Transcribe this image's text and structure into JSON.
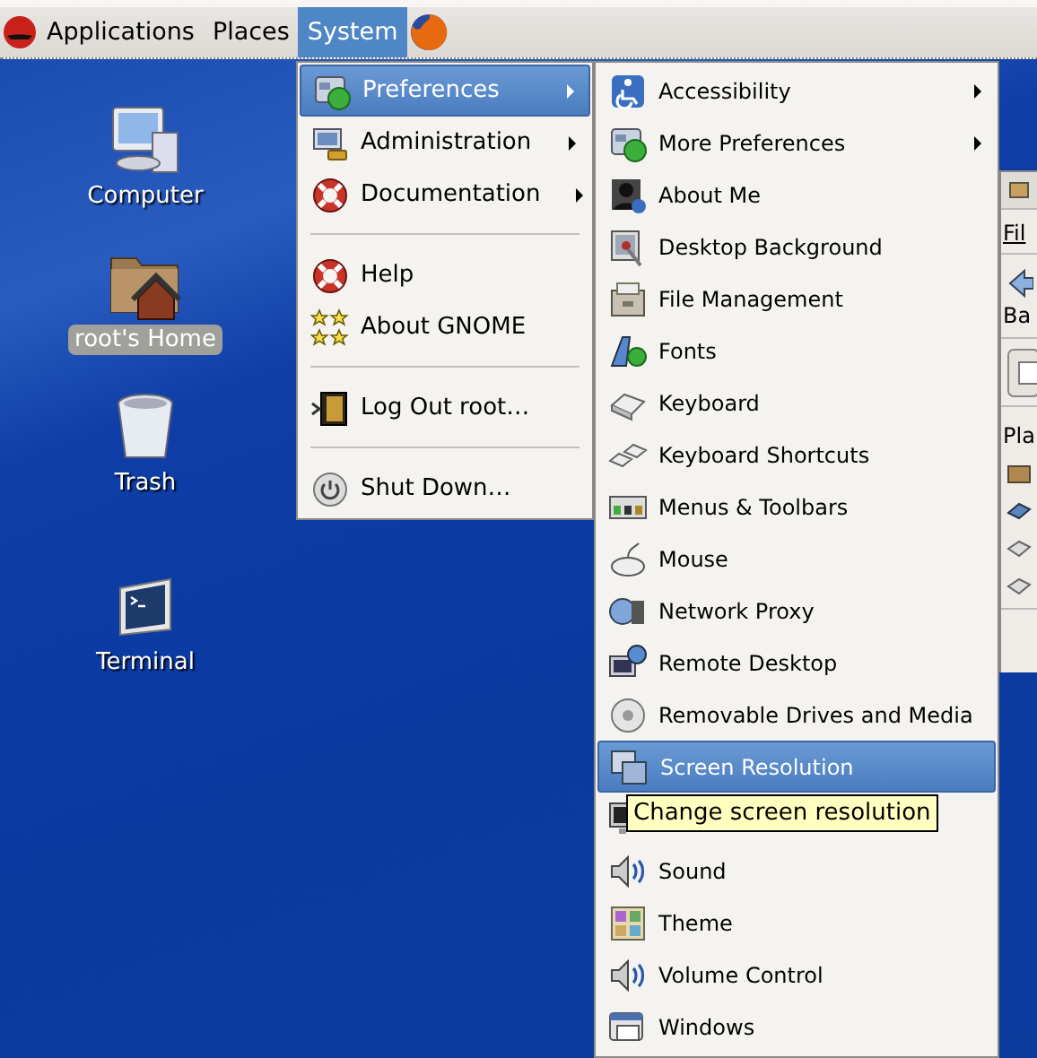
{
  "panel": {
    "menus": [
      {
        "label": "Applications",
        "selected": false
      },
      {
        "label": "Places",
        "selected": false
      },
      {
        "label": "System",
        "selected": true
      }
    ]
  },
  "desktop": {
    "icons": [
      {
        "label": "Computer",
        "selected": false
      },
      {
        "label": "root's Home",
        "selected": true
      },
      {
        "label": "Trash",
        "selected": false
      },
      {
        "label": "Terminal",
        "selected": false
      }
    ]
  },
  "background_window": {
    "menu_label": "Fil",
    "button_label": "Ba",
    "side_label": "Pla"
  },
  "system_menu": {
    "items": [
      {
        "kind": "item",
        "label": "Preferences",
        "submenu": true,
        "selected": true
      },
      {
        "kind": "item",
        "label": "Administration",
        "submenu": true,
        "selected": false
      },
      {
        "kind": "item",
        "label": "Documentation",
        "submenu": true,
        "selected": false
      },
      {
        "kind": "separator"
      },
      {
        "kind": "item",
        "label": "Help",
        "submenu": false,
        "selected": false
      },
      {
        "kind": "item",
        "label": "About GNOME",
        "submenu": false,
        "selected": false
      },
      {
        "kind": "separator"
      },
      {
        "kind": "item",
        "label": "Log Out root…",
        "submenu": false,
        "selected": false
      },
      {
        "kind": "separator"
      },
      {
        "kind": "item",
        "label": "Shut Down…",
        "submenu": false,
        "selected": false
      }
    ]
  },
  "preferences_menu": {
    "items": [
      {
        "kind": "item",
        "label": "Accessibility",
        "submenu": true,
        "selected": false
      },
      {
        "kind": "item",
        "label": "More Preferences",
        "submenu": true,
        "selected": false
      },
      {
        "kind": "item",
        "label": "About Me",
        "submenu": false,
        "selected": false
      },
      {
        "kind": "item",
        "label": "Desktop Background",
        "submenu": false,
        "selected": false
      },
      {
        "kind": "item",
        "label": "File Management",
        "submenu": false,
        "selected": false
      },
      {
        "kind": "item",
        "label": "Fonts",
        "submenu": false,
        "selected": false
      },
      {
        "kind": "item",
        "label": "Keyboard",
        "submenu": false,
        "selected": false
      },
      {
        "kind": "item",
        "label": "Keyboard Shortcuts",
        "submenu": false,
        "selected": false
      },
      {
        "kind": "item",
        "label": "Menus & Toolbars",
        "submenu": false,
        "selected": false
      },
      {
        "kind": "item",
        "label": "Mouse",
        "submenu": false,
        "selected": false
      },
      {
        "kind": "item",
        "label": "Network Proxy",
        "submenu": false,
        "selected": false
      },
      {
        "kind": "item",
        "label": "Remote Desktop",
        "submenu": false,
        "selected": false
      },
      {
        "kind": "item",
        "label": "Removable Drives and Media",
        "submenu": false,
        "selected": false
      },
      {
        "kind": "item",
        "label": "Screen Resolution",
        "submenu": false,
        "selected": true
      },
      {
        "kind": "covered"
      },
      {
        "kind": "item",
        "label": "Sound",
        "submenu": false,
        "selected": false
      },
      {
        "kind": "item",
        "label": "Theme",
        "submenu": false,
        "selected": false
      },
      {
        "kind": "item",
        "label": "Volume Control",
        "submenu": false,
        "selected": false
      },
      {
        "kind": "item",
        "label": "Windows",
        "submenu": false,
        "selected": false
      }
    ]
  },
  "tooltip": {
    "text": "Change screen resolution"
  }
}
